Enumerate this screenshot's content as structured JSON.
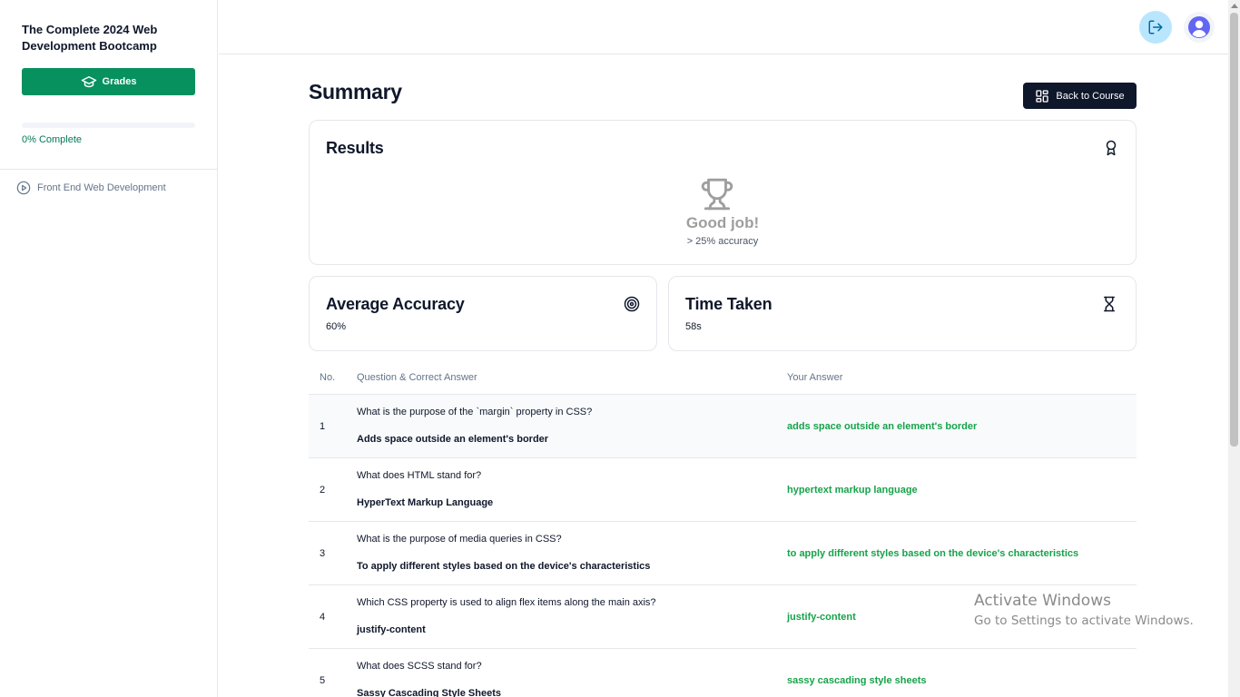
{
  "sidebar": {
    "course_title": "The Complete 2024 Web Development Bootcamp",
    "grades_label": "Grades",
    "progress_percent": 0,
    "progress_label": "0% Complete",
    "chapters": [
      {
        "label": "Front End Web Development",
        "icon": "play-circle-icon"
      }
    ]
  },
  "header": {
    "logout_icon": "logout-icon",
    "avatar_icon": "user-avatar-icon"
  },
  "main": {
    "title": "Summary",
    "back_label": "Back to Course",
    "results": {
      "title": "Results",
      "icon": "award-icon",
      "headline": "Good job!",
      "note": "> 25% accuracy"
    },
    "average_accuracy": {
      "title": "Average Accuracy",
      "value": "60%",
      "icon": "target-icon"
    },
    "time_taken": {
      "title": "Time Taken",
      "value": "58s",
      "icon": "hourglass-icon"
    },
    "table": {
      "headers": {
        "no": "No.",
        "question": "Question & Correct Answer",
        "answer": "Your Answer"
      },
      "rows": [
        {
          "no": "1",
          "question": "What is the purpose of the `margin` property in CSS?",
          "correct": "Adds space outside an element's border",
          "answer": "adds space outside an element's border"
        },
        {
          "no": "2",
          "question": "What does HTML stand for?",
          "correct": "HyperText Markup Language",
          "answer": "hypertext markup language"
        },
        {
          "no": "3",
          "question": "What is the purpose of media queries in CSS?",
          "correct": "To apply different styles based on the device's characteristics",
          "answer": "to apply different styles based on the device's characteristics"
        },
        {
          "no": "4",
          "question": "Which CSS property is used to align flex items along the main axis?",
          "correct": "justify-content",
          "answer": "justify-content"
        },
        {
          "no": "5",
          "question": "What does SCSS stand for?",
          "correct": "Sassy Cascading Style Sheets",
          "answer": "sassy cascading style sheets"
        }
      ]
    }
  },
  "watermark": {
    "title": "Activate Windows",
    "subtitle": "Go to Settings to activate Windows."
  },
  "colors": {
    "brand_green": "#07915f",
    "answer_green": "#16a34a",
    "dark": "#0f172a",
    "muted": "#64748b"
  }
}
